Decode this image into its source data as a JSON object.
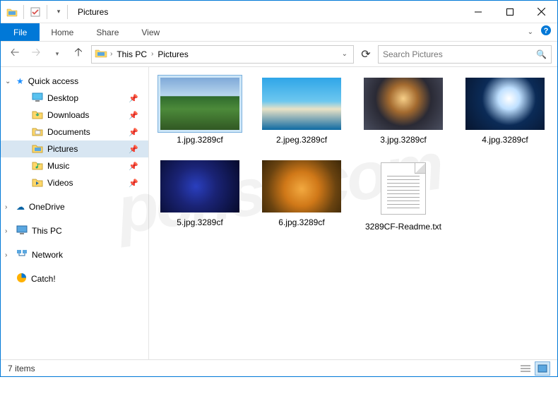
{
  "title": "Pictures",
  "ribbon": {
    "file": "File",
    "tabs": [
      "Home",
      "Share",
      "View"
    ]
  },
  "breadcrumbs": [
    "This PC",
    "Pictures"
  ],
  "search_placeholder": "Search Pictures",
  "nav": {
    "quick_access": "Quick access",
    "quick_items": [
      {
        "label": "Desktop",
        "icon": "desktop"
      },
      {
        "label": "Downloads",
        "icon": "downloads"
      },
      {
        "label": "Documents",
        "icon": "documents"
      },
      {
        "label": "Pictures",
        "icon": "pictures",
        "selected": true
      },
      {
        "label": "Music",
        "icon": "music"
      },
      {
        "label": "Videos",
        "icon": "videos"
      }
    ],
    "onedrive": "OneDrive",
    "thispc": "This PC",
    "network": "Network",
    "catch": "Catch!"
  },
  "files": [
    {
      "name": "1.jpg.3289cf",
      "type": "img",
      "selected": true,
      "bg": "linear-gradient(to bottom,#7fa9d8 0%,#b9d7ee 35%,#2f6b2d 36%,#4c8a3a 60%,#315823 100%)"
    },
    {
      "name": "2.jpeg.3289cf",
      "type": "img",
      "bg": "linear-gradient(to bottom,#2fa5e8 0%,#6cc7ef 45%,#e9e2c6 60%,#0e6aa3 100%)"
    },
    {
      "name": "3.jpg.3289cf",
      "type": "img",
      "bg": "radial-gradient(circle at 50% 40%, #f7cf88 0%, #a36a2f 28%, #2a2a35 55%, #4a4e5f 100%)"
    },
    {
      "name": "4.jpg.3289cf",
      "type": "img",
      "bg": "radial-gradient(circle at 55% 40%, #ffffff 0%, #bfe0ff 20%, #0b2b57 50%, #07152e 100%)"
    },
    {
      "name": "5.jpg.3289cf",
      "type": "img",
      "bg": "radial-gradient(circle at 45% 50%, #2a3fbf 0%, #1a2375 40%, #060a2a 100%)"
    },
    {
      "name": "6.jpg.3289cf",
      "type": "img",
      "bg": "radial-gradient(circle at 50% 55%, #f2a940 0%, #d07818 35%, #6a4310 70%, #3d2808 100%)"
    },
    {
      "name": "3289CF-Readme.txt",
      "type": "txt"
    }
  ],
  "status": "7 items"
}
